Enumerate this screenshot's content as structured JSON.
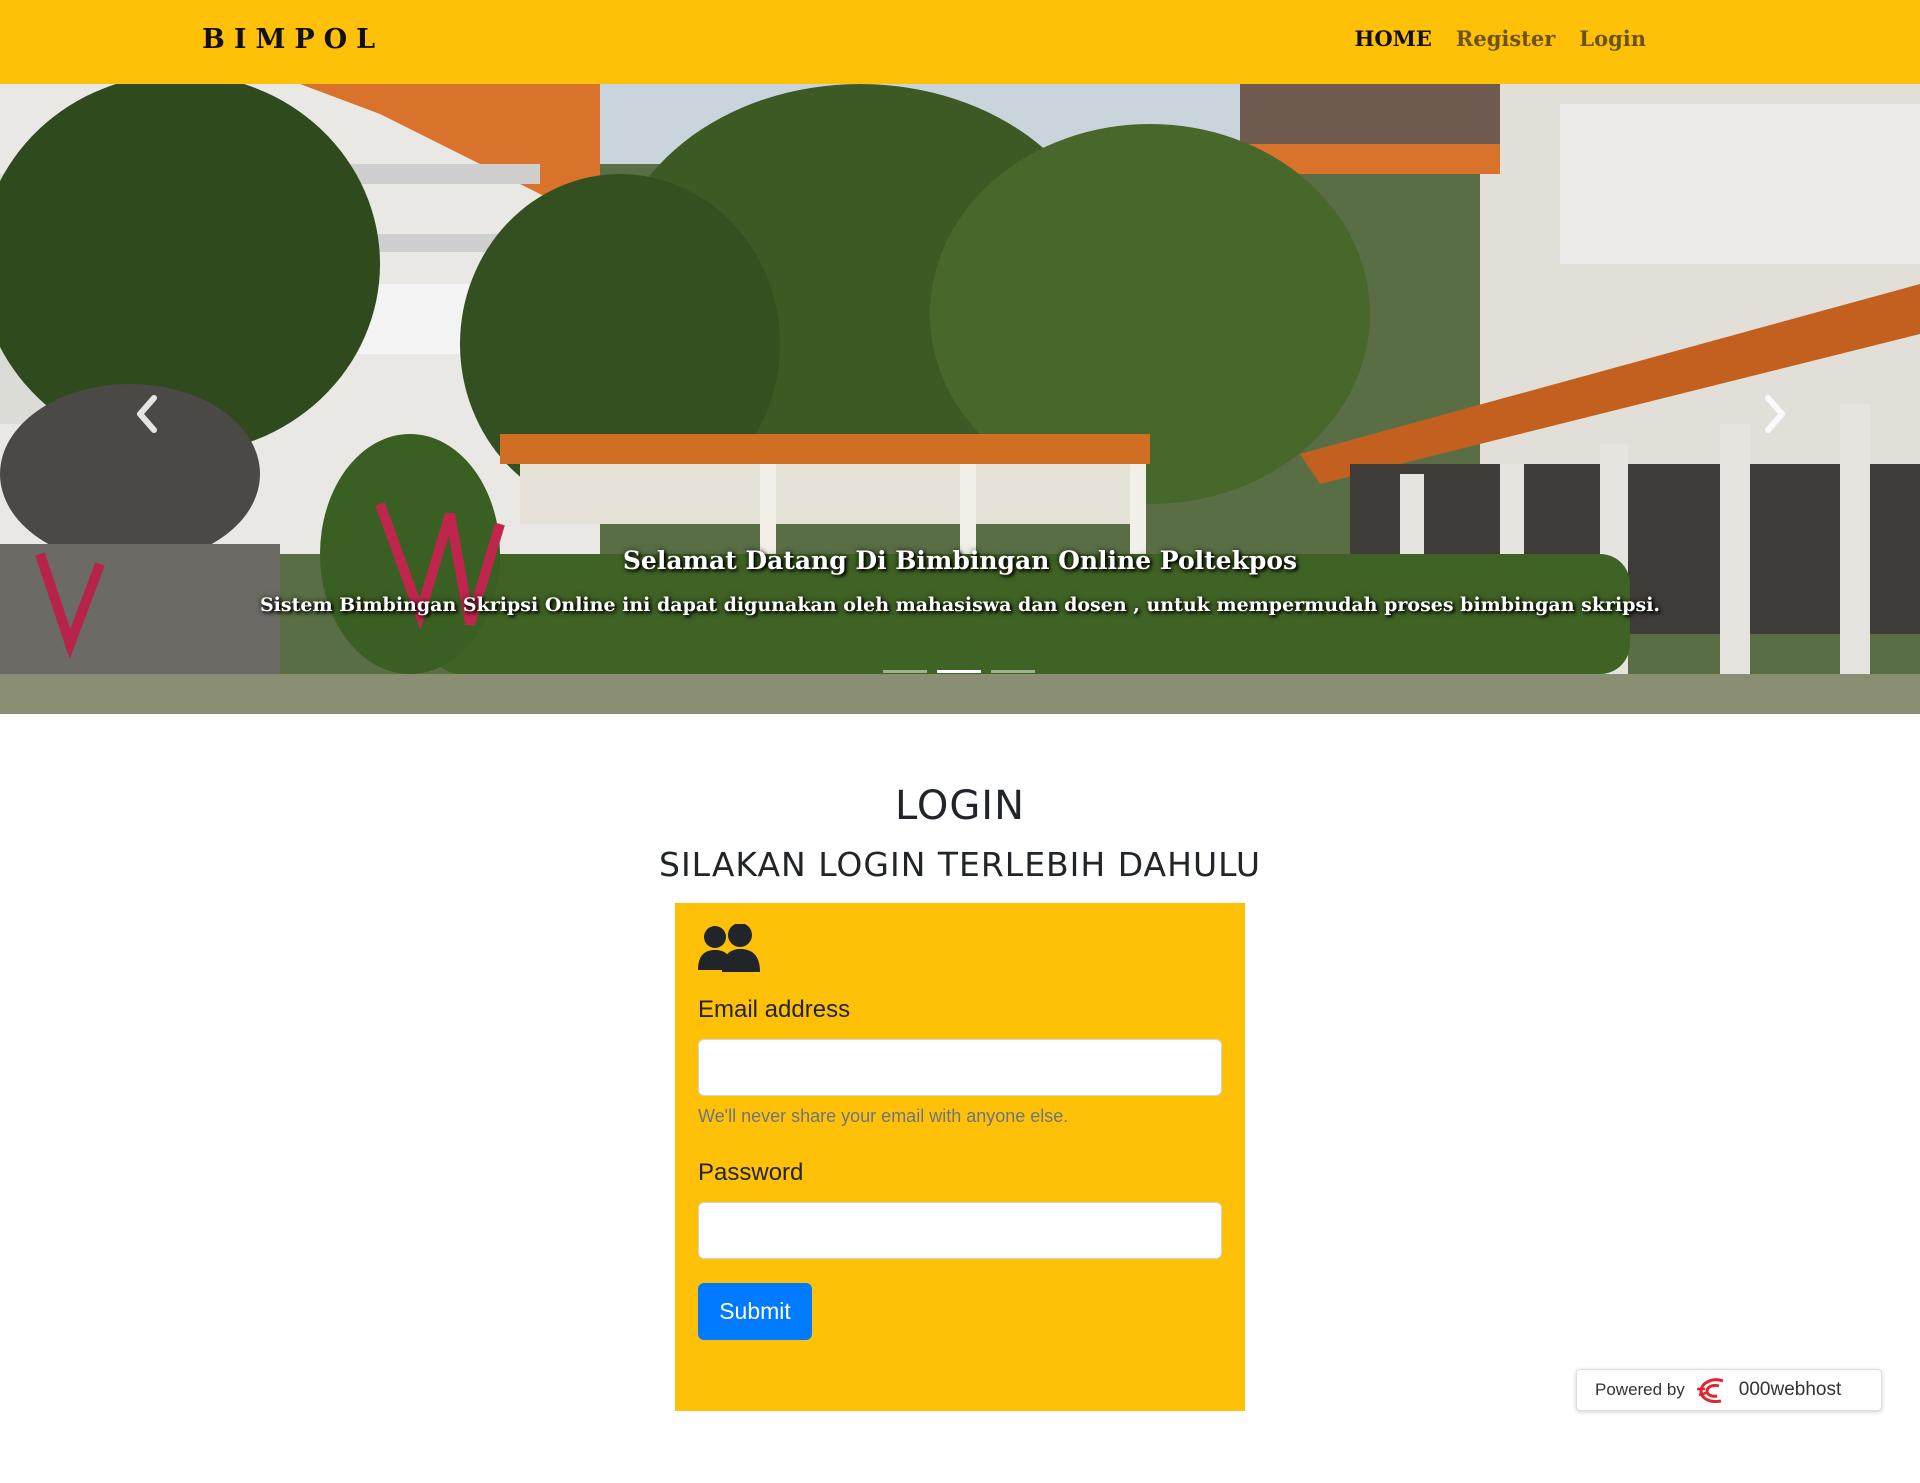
{
  "navbar": {
    "brand": "BIMPOL",
    "links": [
      {
        "label": "HOME",
        "active": true
      },
      {
        "label": "Register",
        "active": false
      },
      {
        "label": "Login",
        "active": false
      }
    ]
  },
  "hero": {
    "title": "Selamat Datang Di Bimbingan Online Poltekpos",
    "subtitle": "Sistem Bimbingan Skripsi Online ini dapat digunakan oleh mahasiswa dan dosen , untuk mempermudah proses bimbingan skripsi.",
    "slide_count": 3,
    "active_slide": 2,
    "prev_icon": "chevron-left-icon",
    "next_icon": "chevron-right-icon"
  },
  "login": {
    "title": "LOGIN",
    "subtitle": "SILAKAN LOGIN TERLEBIH DAHULU",
    "icon": "users-icon",
    "email_label": "Email address",
    "email_value": "",
    "email_help": "We'll never share your email with anyone else.",
    "password_label": "Password",
    "password_value": "",
    "submit_label": "Submit"
  },
  "footer_badge": {
    "label": "Powered by",
    "brand": "000webhost",
    "icon": "000webhost-logo-icon"
  },
  "colors": {
    "navbar": "#ffc107",
    "card": "#ffc107",
    "submit": "#007bff",
    "nav_active": "#111111",
    "nav_inactive": "#6b5416"
  }
}
